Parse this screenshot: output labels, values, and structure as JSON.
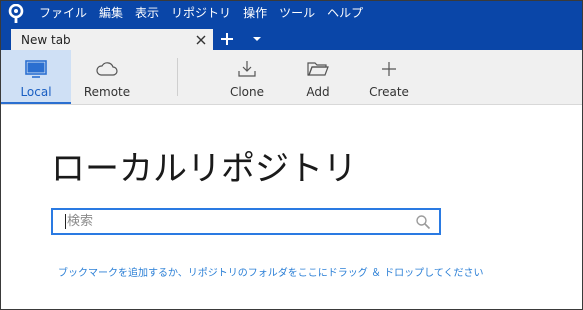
{
  "menubar": {
    "items": [
      "ファイル",
      "編集",
      "表示",
      "リポジトリ",
      "操作",
      "ツール",
      "ヘルプ"
    ]
  },
  "tabs": [
    {
      "label": "New tab",
      "active": true
    }
  ],
  "toolbar": {
    "items": [
      {
        "label": "Local",
        "icon": "monitor-icon",
        "active": true
      },
      {
        "label": "Remote",
        "icon": "cloud-icon",
        "active": false
      },
      {
        "label": "Clone",
        "icon": "download-icon",
        "active": false
      },
      {
        "label": "Add",
        "icon": "folder-icon",
        "active": false
      },
      {
        "label": "Create",
        "icon": "plus-icon",
        "active": false
      }
    ]
  },
  "main": {
    "title": "ローカルリポジトリ",
    "search": {
      "placeholder": "検索",
      "value": ""
    },
    "hint": "ブックマークを追加するか、リポジトリのフォルダをここにドラッグ ＆ ドロップしてください"
  },
  "colors": {
    "titlebar": "#0a46a8",
    "accent": "#2a7ae2",
    "link": "#2b7fd6",
    "toolbar_bg": "#f0f0f0",
    "active_tool_bg": "#cfe0f5"
  }
}
